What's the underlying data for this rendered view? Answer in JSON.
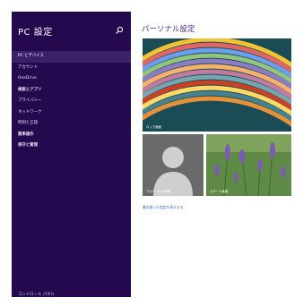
{
  "nav": {
    "title": "PC 設定",
    "search_icon": "search-icon",
    "items": [
      {
        "label": "PC とデバイス",
        "selected": true,
        "bold": false
      },
      {
        "label": "アカウント",
        "selected": false,
        "bold": false
      },
      {
        "label": "OneDrive",
        "selected": false,
        "bold": false
      },
      {
        "label": "検索とアプリ",
        "selected": false,
        "bold": true
      },
      {
        "label": "プライバシー",
        "selected": false,
        "bold": false
      },
      {
        "label": "ネットワーク",
        "selected": false,
        "bold": false
      },
      {
        "label": "時刻と言語",
        "selected": false,
        "bold": false
      },
      {
        "label": "簡単操作",
        "selected": false,
        "bold": true
      },
      {
        "label": "保守と管理",
        "selected": false,
        "bold": true
      }
    ],
    "footer": "コントロール パネル"
  },
  "main": {
    "title": "パーソナル設定",
    "tiles": {
      "lock_screen": {
        "caption": "ロック画面"
      },
      "account_picture": {
        "caption": "アカウントの画像"
      },
      "start_screen": {
        "caption": "スタート画面"
      }
    },
    "more_link": "最近使った設定を表示する"
  },
  "colors": {
    "nav_background": "#25094f",
    "nav_selected": "#3a2068",
    "accent_title": "#4b2b86",
    "link": "#3a5fb2"
  }
}
